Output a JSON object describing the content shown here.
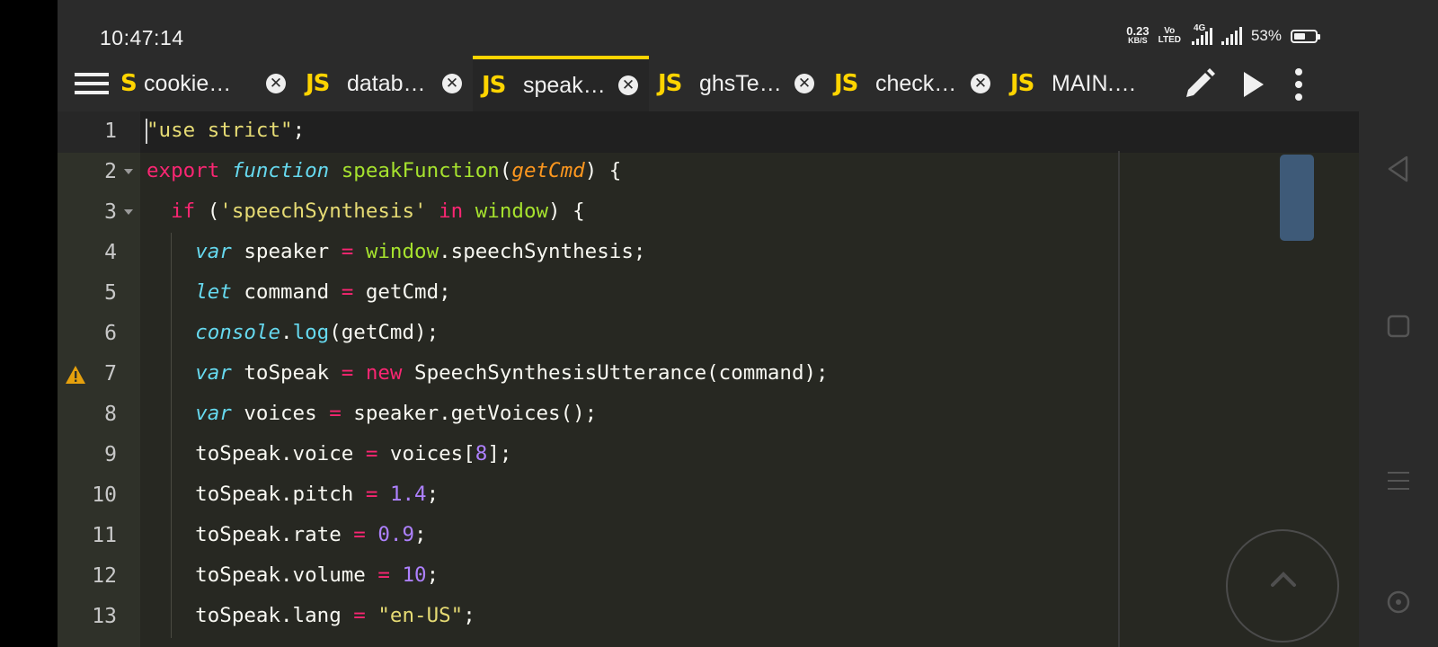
{
  "status_bar": {
    "time": "10:47:14",
    "net_speed_value": "0.23",
    "net_speed_unit": "KB/S",
    "volte_line1": "Vo",
    "volte_line2": "LTED",
    "network_type": "4G",
    "battery_percent": "53%",
    "battery_level": 0.53
  },
  "tabs": [
    {
      "icon": "S",
      "label": "cookie…",
      "active": false
    },
    {
      "icon": "JS",
      "label": "datab…",
      "active": false
    },
    {
      "icon": "JS",
      "label": "speak…",
      "active": true
    },
    {
      "icon": "JS",
      "label": "ghsTe…",
      "active": false
    },
    {
      "icon": "JS",
      "label": "check…",
      "active": false
    },
    {
      "icon": "JS",
      "label": "MAIN.…",
      "active": false
    }
  ],
  "tab_close_glyph": "✕",
  "toolbar": {
    "menu_icon": "hamburger-icon",
    "edit_icon": "pencil-icon",
    "run_icon": "play-icon",
    "more_icon": "more-vertical-icon"
  },
  "editor": {
    "language": "JavaScript",
    "active_line": 1,
    "warning_line": 7,
    "lines": [
      {
        "n": "1",
        "tokens": [
          [
            "str",
            "\"use strict\""
          ],
          [
            "",
            "; "
          ]
        ]
      },
      {
        "n": "2",
        "fold": true,
        "tokens": [
          [
            "kw",
            "export"
          ],
          [
            "",
            " "
          ],
          [
            "st",
            "function"
          ],
          [
            "",
            " "
          ],
          [
            "fn",
            "speakFunction"
          ],
          [
            "",
            "("
          ],
          [
            "par",
            "getCmd"
          ],
          [
            "",
            ") {"
          ]
        ]
      },
      {
        "n": "3",
        "fold": true,
        "tokens": [
          [
            "",
            "  "
          ],
          [
            "kw",
            "if"
          ],
          [
            "",
            " ("
          ],
          [
            "str",
            "'speechSynthesis'"
          ],
          [
            "",
            " "
          ],
          [
            "kw",
            "in"
          ],
          [
            "",
            " "
          ],
          [
            "fn",
            "window"
          ],
          [
            "",
            ") {"
          ]
        ]
      },
      {
        "n": "4",
        "tokens": [
          [
            "",
            "    "
          ],
          [
            "st",
            "var"
          ],
          [
            "",
            " speaker "
          ],
          [
            "kw",
            "="
          ],
          [
            "",
            " "
          ],
          [
            "fn",
            "window"
          ],
          [
            "",
            ".speechSynthesis;"
          ]
        ]
      },
      {
        "n": "5",
        "tokens": [
          [
            "",
            "    "
          ],
          [
            "st",
            "let"
          ],
          [
            "",
            " command "
          ],
          [
            "kw",
            "="
          ],
          [
            "",
            " getCmd;"
          ]
        ]
      },
      {
        "n": "6",
        "tokens": [
          [
            "",
            "    "
          ],
          [
            "st",
            "console"
          ],
          [
            "",
            "."
          ],
          [
            "sup",
            "log"
          ],
          [
            "",
            "(getCmd);"
          ]
        ]
      },
      {
        "n": "7",
        "tokens": [
          [
            "",
            "    "
          ],
          [
            "st",
            "var"
          ],
          [
            "",
            " toSpeak "
          ],
          [
            "kw",
            "="
          ],
          [
            "",
            " "
          ],
          [
            "kw",
            "new"
          ],
          [
            "",
            " SpeechSynthesisUtterance(command);"
          ]
        ]
      },
      {
        "n": "8",
        "tokens": [
          [
            "",
            "    "
          ],
          [
            "st",
            "var"
          ],
          [
            "",
            " voices "
          ],
          [
            "kw",
            "="
          ],
          [
            "",
            " speaker.getVoices();"
          ]
        ]
      },
      {
        "n": "9",
        "tokens": [
          [
            "",
            "    toSpeak.voice "
          ],
          [
            "kw",
            "="
          ],
          [
            "",
            " voices["
          ],
          [
            "num",
            "8"
          ],
          [
            "",
            "];"
          ]
        ]
      },
      {
        "n": "10",
        "tokens": [
          [
            "",
            "    toSpeak.pitch "
          ],
          [
            "kw",
            "="
          ],
          [
            "",
            " "
          ],
          [
            "num",
            "1.4"
          ],
          [
            "",
            ";"
          ]
        ]
      },
      {
        "n": "11",
        "tokens": [
          [
            "",
            "    toSpeak.rate "
          ],
          [
            "kw",
            "="
          ],
          [
            "",
            " "
          ],
          [
            "num",
            "0.9"
          ],
          [
            "",
            ";"
          ]
        ]
      },
      {
        "n": "12",
        "tokens": [
          [
            "",
            "    toSpeak.volume "
          ],
          [
            "kw",
            "="
          ],
          [
            "",
            " "
          ],
          [
            "num",
            "10"
          ],
          [
            "",
            ";"
          ]
        ]
      },
      {
        "n": "13",
        "tokens": [
          [
            "",
            "    toSpeak.lang "
          ],
          [
            "kw",
            "="
          ],
          [
            "",
            " "
          ],
          [
            "str",
            "\"en-US\""
          ],
          [
            "",
            ";"
          ]
        ]
      }
    ]
  },
  "colors": {
    "accent": "#ffd400",
    "editor_bg": "#272822",
    "keyword": "#f92672",
    "storage": "#66d9ef",
    "function": "#a6e22e",
    "parameter": "#fd971f",
    "string": "#e6db74",
    "number": "#ae81ff",
    "scroll_thumb": "#3e5a78"
  },
  "system_nav": {
    "back_icon": "back-triangle-icon",
    "home_icon": "square-home-icon",
    "menu_icon": "three-lines-menu-icon",
    "assist_icon": "circle-dot-icon"
  }
}
